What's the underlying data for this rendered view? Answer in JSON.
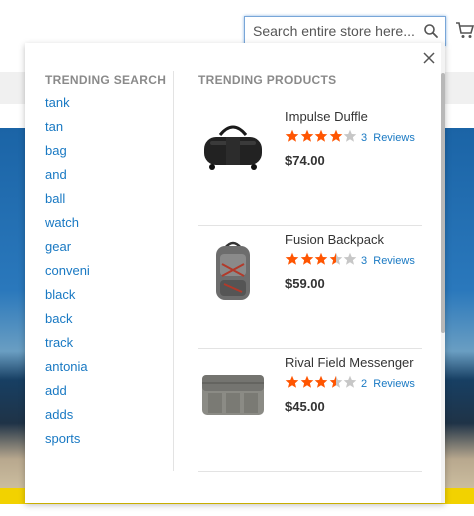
{
  "search": {
    "placeholder": "Search entire store here..."
  },
  "dropdown": {
    "trending_search_title": "TRENDING SEARCH",
    "trending_products_title": "TRENDING PRODUCTS",
    "terms": [
      "tank",
      "tan",
      "bag",
      "and",
      "ball",
      "watch",
      "gear",
      "conveni",
      "black",
      "back",
      "track",
      "antonia",
      "add",
      "adds",
      "sports"
    ],
    "products": [
      {
        "name": "Impulse Duffle",
        "rating_stars": 4.0,
        "review_count": "3",
        "reviews_label": "Reviews",
        "price": "$74.00"
      },
      {
        "name": "Fusion Backpack",
        "rating_stars": 3.5,
        "review_count": "3",
        "reviews_label": "Reviews",
        "price": "$59.00"
      },
      {
        "name": "Rival Field Messenger",
        "rating_stars": 3.5,
        "review_count": "2",
        "reviews_label": "Reviews",
        "price": "$45.00"
      }
    ]
  },
  "colors": {
    "link": "#1979c3",
    "star_filled": "#ff5501",
    "star_empty": "#c7c7c7",
    "search_border": "#78a6d8",
    "banner_yellow": "#f2d200"
  },
  "icons": {
    "search": "search-icon",
    "cart": "cart-icon",
    "close": "close-icon"
  }
}
